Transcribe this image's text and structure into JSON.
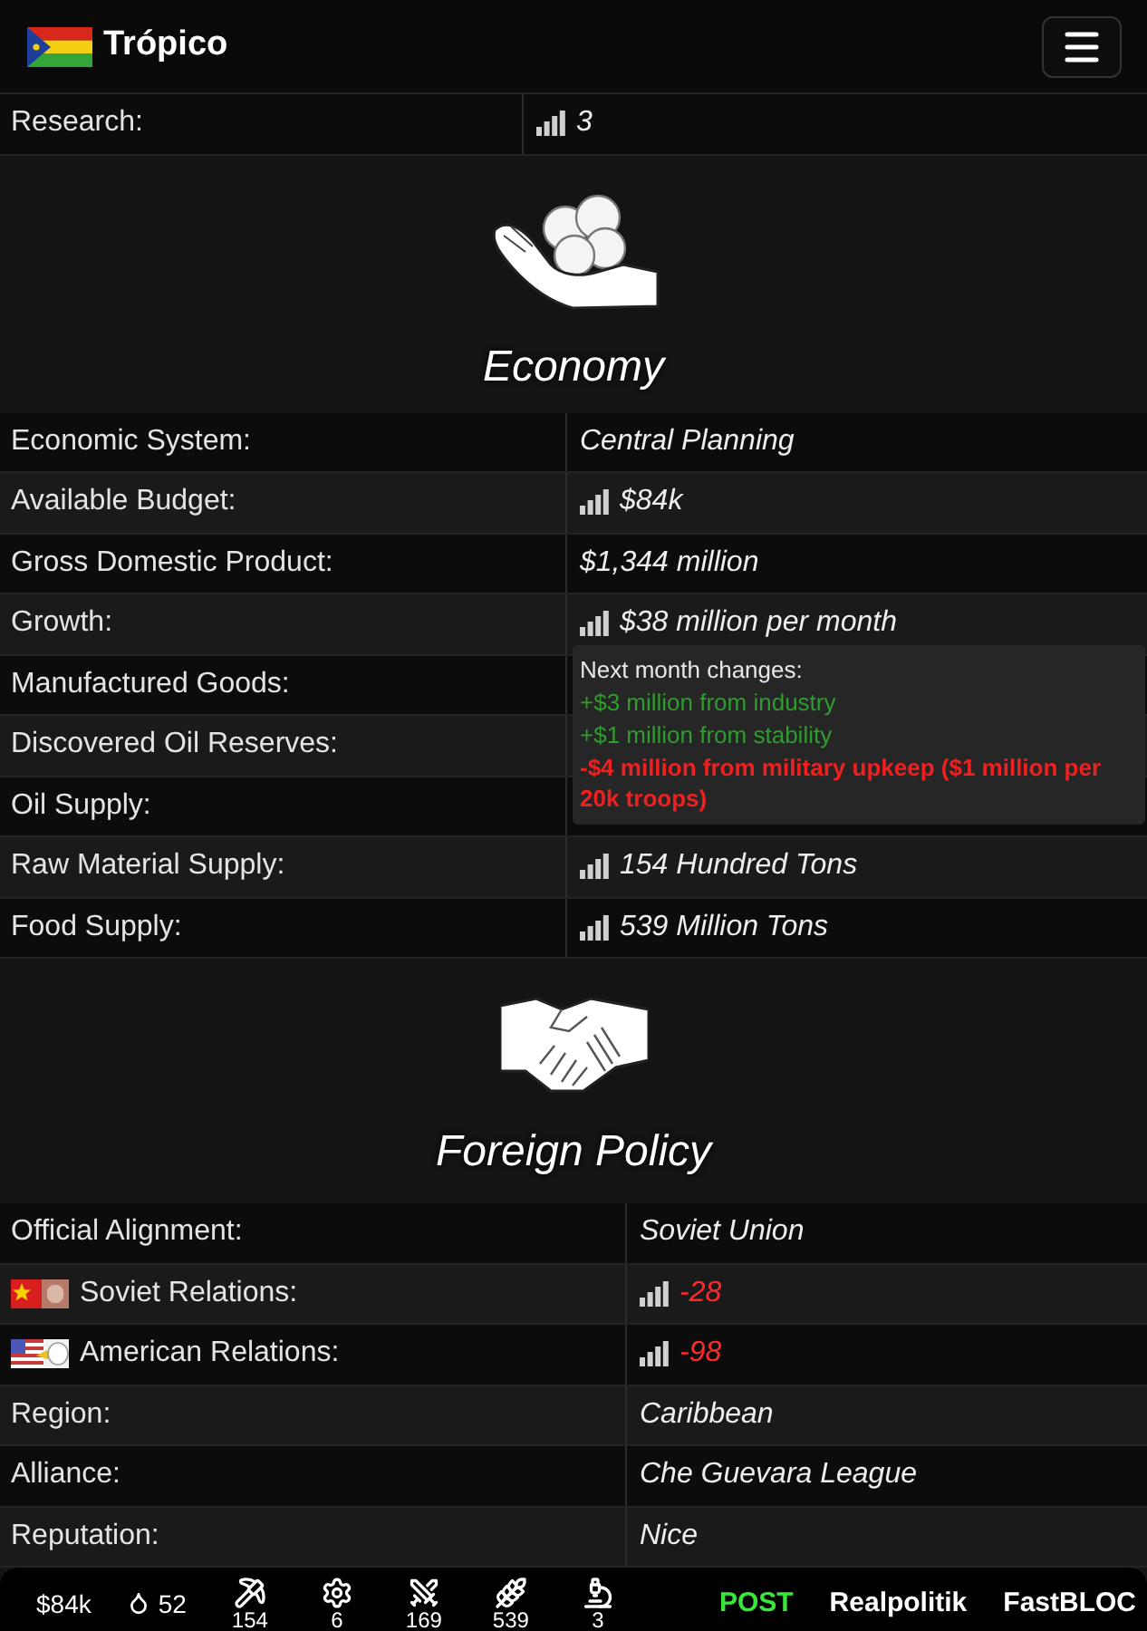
{
  "header": {
    "title": "Trópico"
  },
  "top_rows": [
    {
      "label": "Research:",
      "value": {
        "text": "3",
        "stats_icon": true,
        "negative": false
      }
    }
  ],
  "sections": [
    {
      "kind": "economy",
      "title": "Economy",
      "rows": [
        {
          "kind": "plain",
          "label": "Economic System:",
          "value": {
            "text": "Central Planning",
            "stats_icon": false,
            "negative": false
          }
        },
        {
          "kind": "plain",
          "label": "Available Budget:",
          "value": {
            "text": "$84k",
            "stats_icon": true,
            "negative": false
          }
        },
        {
          "kind": "plain",
          "label": "Gross Domestic Product:",
          "value": {
            "text": "$1,344 million",
            "stats_icon": false,
            "negative": false
          }
        },
        {
          "kind": "plain",
          "label": "Growth:",
          "value": {
            "text": "$38 million per month",
            "stats_icon": true,
            "negative": false
          }
        },
        {
          "kind": "plain",
          "label": "Manufactured Goods:"
        },
        {
          "kind": "plain",
          "label": "Discovered Oil Reserves:"
        },
        {
          "kind": "plain",
          "label": "Oil Supply:"
        },
        {
          "kind": "plain",
          "label": "Raw Material Supply:",
          "value": {
            "text": "154 Hundred Tons",
            "stats_icon": true,
            "negative": false
          }
        },
        {
          "kind": "plain",
          "label": "Food Supply:",
          "value": {
            "text": "539 Million Tons",
            "stats_icon": true,
            "negative": false
          }
        }
      ],
      "tooltip": {
        "title": "Next month changes:",
        "lines": [
          {
            "text": "+$3 million from industry",
            "kind": "gain"
          },
          {
            "text": "+$1 million from stability",
            "kind": "gain"
          },
          {
            "text": "-$4 million from military upkeep ($1 million per 20k troops)",
            "kind": "loss"
          }
        ]
      }
    },
    {
      "kind": "foreign",
      "title": "Foreign Policy",
      "rows": [
        {
          "kind": "plain",
          "label": "Official Alignment:",
          "value": {
            "text": "Soviet Union",
            "stats_icon": false,
            "negative": false
          }
        },
        {
          "kind": "soviet_flag",
          "label": "Soviet Relations:",
          "value": {
            "text": "-28",
            "stats_icon": true,
            "negative": true
          }
        },
        {
          "kind": "american_flag",
          "label": "American Relations:",
          "value": {
            "text": "-98",
            "stats_icon": true,
            "negative": true
          }
        },
        {
          "kind": "plain",
          "label": "Region:",
          "value": {
            "text": "Caribbean",
            "stats_icon": false,
            "negative": false
          }
        },
        {
          "kind": "plain",
          "label": "Alliance:",
          "value": {
            "text": "Che Guevara League",
            "stats_icon": false,
            "negative": false
          }
        },
        {
          "kind": "plain",
          "label": "Reputation:",
          "value": {
            "text": "Nice",
            "stats_icon": false,
            "negative": false
          }
        }
      ]
    }
  ],
  "bottom_bar": {
    "budget": "$84k",
    "oil": "52",
    "resources": [
      {
        "value": "154"
      },
      {
        "value": "6"
      },
      {
        "value": "169"
      },
      {
        "value": "539"
      },
      {
        "value": "3"
      }
    ],
    "links": [
      {
        "label": "POST",
        "highlighted": true
      },
      {
        "label": "Realpolitik",
        "highlighted": false
      },
      {
        "label": "FastBLOC",
        "highlighted": false
      }
    ]
  }
}
